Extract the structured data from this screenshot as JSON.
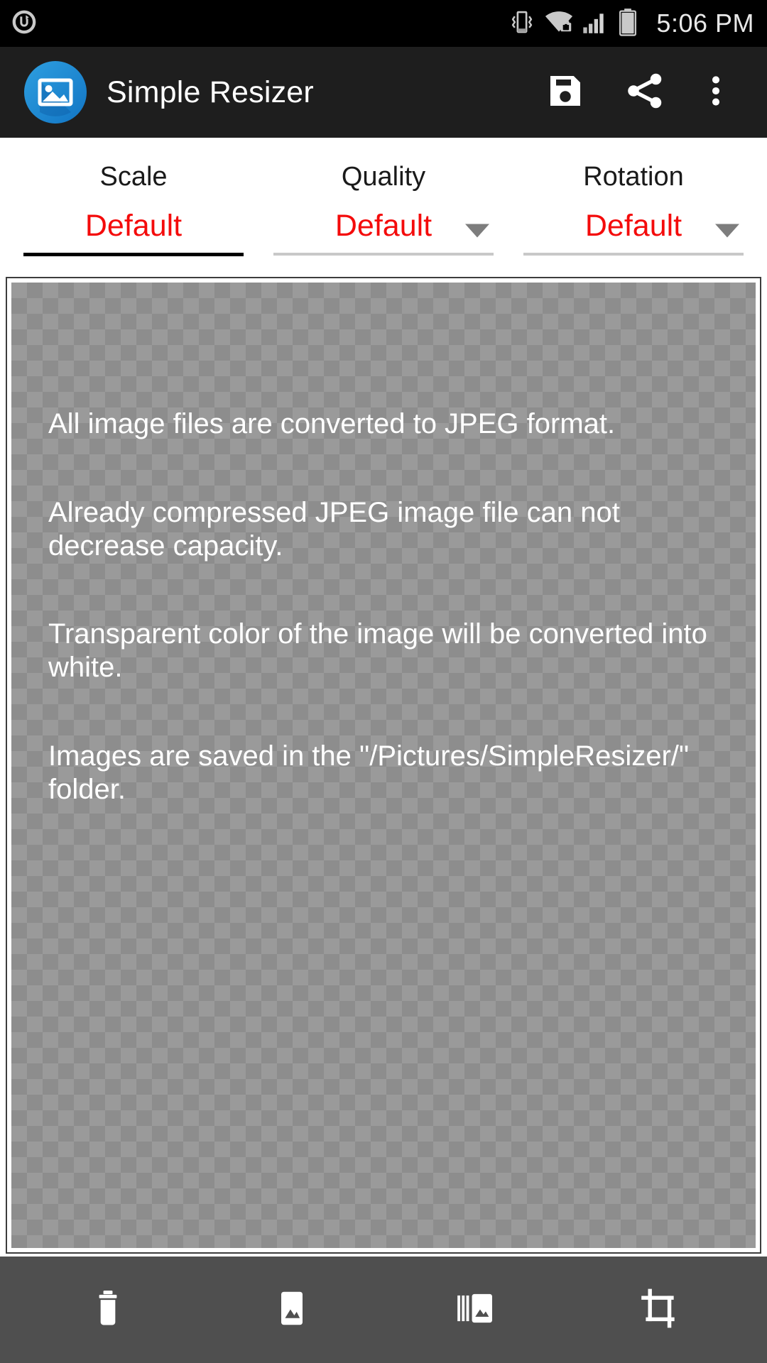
{
  "status_bar": {
    "time": "5:06 PM",
    "icons": {
      "notification": "app-notification-icon",
      "vibrate": "vibrate-mode-icon",
      "wifi": "wifi-secured-icon",
      "signal": "cellular-signal-icon",
      "battery": "battery-full-icon"
    },
    "colors": {
      "background": "#000000",
      "foreground": "#e8e8e8"
    }
  },
  "app_bar": {
    "title": "Simple Resizer",
    "logo_icon": "app-image-logo-icon",
    "background": "#1e1e1e",
    "actions": [
      {
        "name": "save-button",
        "icon": "save-floppy-icon"
      },
      {
        "name": "share-button",
        "icon": "share-icon"
      },
      {
        "name": "overflow-menu-button",
        "icon": "more-vertical-icon"
      }
    ]
  },
  "options": {
    "accent_color": "#f40b0b",
    "items": [
      {
        "label": "Scale",
        "value": "Default",
        "has_caret": false,
        "active": true
      },
      {
        "label": "Quality",
        "value": "Default",
        "has_caret": true,
        "active": false
      },
      {
        "label": "Rotation",
        "value": "Default",
        "has_caret": true,
        "active": false
      }
    ]
  },
  "preview": {
    "checker_color_light": "#9a9a9a",
    "checker_color_dark": "#8d8d8d",
    "text_color": "#ffffff",
    "paragraphs": [
      "All image files are converted to JPEG format.",
      "Already compressed JPEG image file can not decrease capacity.",
      "Transparent color of the image will be converted into white.",
      "Images are saved in the \"/Pictures/SimpleResizer/\" folder."
    ]
  },
  "bottom_bar": {
    "background": "#4f4f4f",
    "buttons": [
      {
        "name": "delete-button",
        "icon": "trash-icon"
      },
      {
        "name": "pick-image-button",
        "icon": "single-image-icon"
      },
      {
        "name": "multi-image-button",
        "icon": "multiple-images-icon"
      },
      {
        "name": "crop-button",
        "icon": "crop-icon"
      }
    ]
  }
}
